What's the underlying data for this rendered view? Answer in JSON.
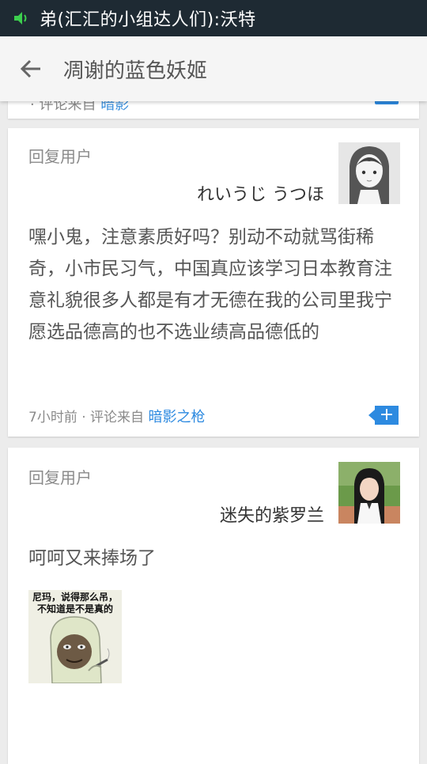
{
  "status_bar": {
    "notification_text": "弟(汇汇的小组达人们):沃特",
    "icon": "speaker-icon"
  },
  "app_bar": {
    "back_icon": "back-arrow-icon",
    "title": "凋谢的蓝色妖姬"
  },
  "partial_card": {
    "meta_fragment": "· 评论来自",
    "link_fragment": "暗影"
  },
  "comments": [
    {
      "reply_label": "回复用户",
      "username": "れいうじ うつほ",
      "text": "嘿小鬼，注意素质好吗？别动不动就骂街稀奇，小市民习气，中国真应该学习日本教育注意礼貌很多人都是有才无德在我的公司里我宁愿选品德高的也不选业绩高品德低的",
      "time": "7小时前",
      "separator": "·",
      "source_label": "评论来自",
      "source_name": "暗影之枪",
      "reply_icon": "plus-icon"
    },
    {
      "reply_label": "回复用户",
      "username": "迷失的紫罗兰",
      "text": "呵呵又来捧场了",
      "sticker_caption_line1": "尼玛，说得那么吊，",
      "sticker_caption_line2": "不知道是不是真的"
    }
  ],
  "colors": {
    "status_bar_bg": "#1e2a33",
    "app_bar_bg": "#f5f5f5",
    "accent_blue": "#2d8ae0",
    "page_bg": "#ececec"
  }
}
